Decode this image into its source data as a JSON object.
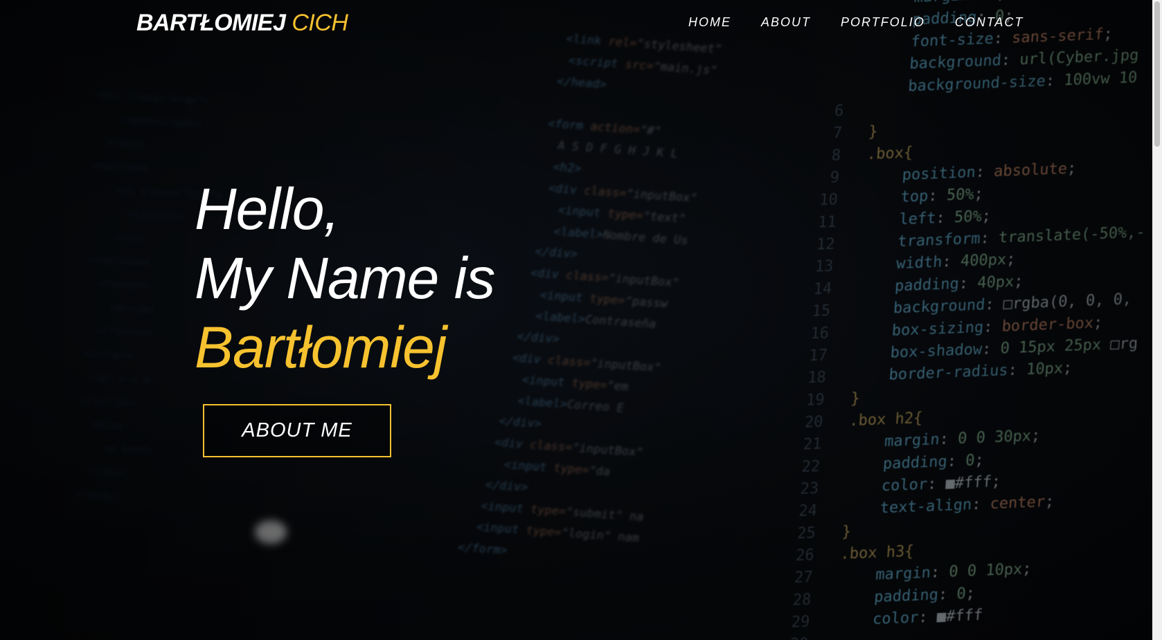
{
  "navbar": {
    "brand_first": "BARTŁOMIEJ",
    "brand_second": "CICH",
    "links": [
      "HOME",
      "ABOUT",
      "PORTFOLIO",
      "CONTACT"
    ]
  },
  "hero": {
    "line1": "Hello,",
    "line2": "My Name is",
    "line3": "Bartłomiej",
    "button_label": "ABOUT ME"
  },
  "colors": {
    "accent": "#f7c22f",
    "text": "#ffffff",
    "background": "#000000"
  }
}
